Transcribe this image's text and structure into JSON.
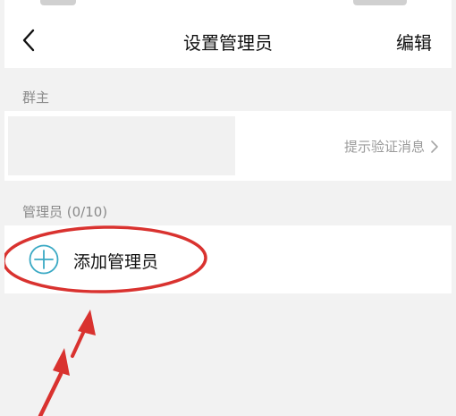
{
  "header": {
    "title": "设置管理员",
    "edit_label": "编辑",
    "back_icon": "chevron-left-icon"
  },
  "owner_section": {
    "label": "群主",
    "verify_label": "提示验证消息",
    "verify_icon": "chevron-right-icon"
  },
  "admin_section": {
    "label": "管理员 (0/10)",
    "add_label": "添加管理员",
    "add_icon": "plus-circle-icon",
    "add_icon_color": "#3aa9c4"
  },
  "annotation": {
    "color": "#d9322f"
  }
}
